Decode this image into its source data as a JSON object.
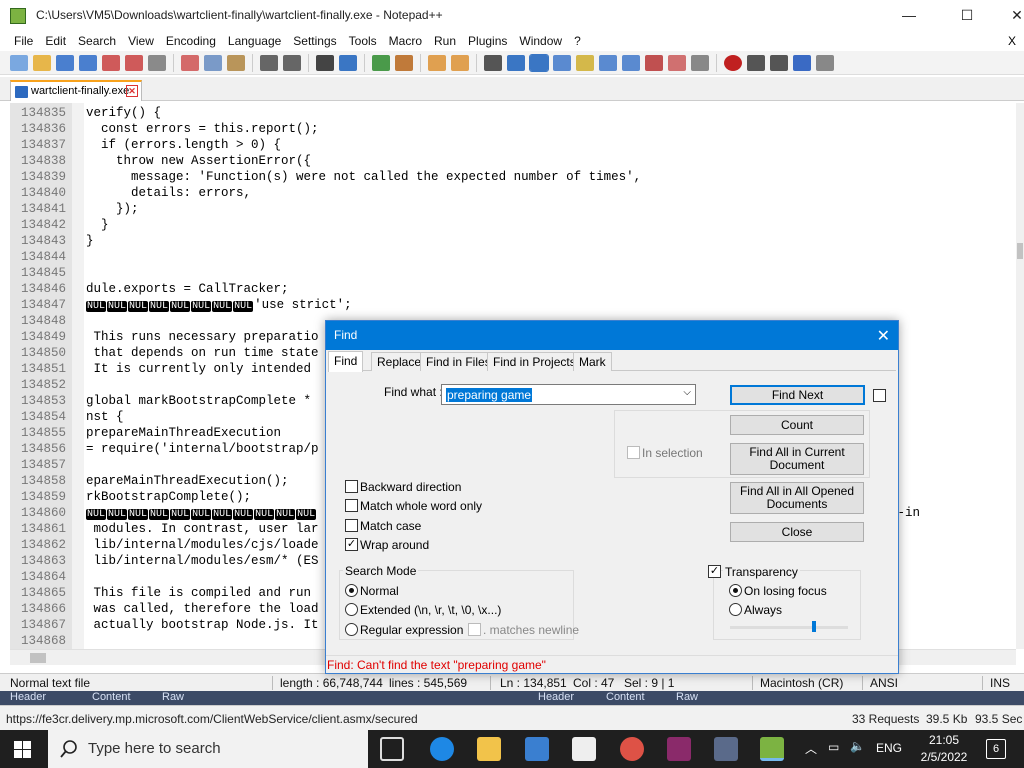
{
  "window": {
    "title": "C:\\Users\\VM5\\Downloads\\wartclient-finally\\wartclient-finally.exe - Notepad++",
    "minimize": "—",
    "maximize": "☐",
    "close": "✕"
  },
  "menu": {
    "items": [
      "File",
      "Edit",
      "Search",
      "View",
      "Encoding",
      "Language",
      "Settings",
      "Tools",
      "Macro",
      "Run",
      "Plugins",
      "Window",
      "?"
    ],
    "close_x": "X"
  },
  "tab": {
    "label": "wartclient-finally.exe",
    "close": "✕"
  },
  "editor": {
    "lines": [
      {
        "n": "134835",
        "code": "verify() {"
      },
      {
        "n": "134836",
        "code": "  const errors = this.report();"
      },
      {
        "n": "134837",
        "code": "  if (errors.length > 0) {"
      },
      {
        "n": "134838",
        "code": "    throw new AssertionError({"
      },
      {
        "n": "134839",
        "code": "      message: 'Function(s) were not called the expected number of times',"
      },
      {
        "n": "134840",
        "code": "      details: errors,"
      },
      {
        "n": "134841",
        "code": "    });"
      },
      {
        "n": "134842",
        "code": "  }"
      },
      {
        "n": "134843",
        "code": "}"
      },
      {
        "n": "134844",
        "code": ""
      },
      {
        "n": "134845",
        "code": ""
      },
      {
        "n": "134846",
        "code": "dule.exports = CallTracker;"
      },
      {
        "n": "134847",
        "code": "'use strict';",
        "nul": 8
      },
      {
        "n": "134848",
        "code": ""
      },
      {
        "n": "134849",
        "code": " This runs necessary preparatio"
      },
      {
        "n": "134850",
        "code": " that depends on run time state"
      },
      {
        "n": "134851",
        "code": " It is currently only intended"
      },
      {
        "n": "134852",
        "code": ""
      },
      {
        "n": "134853",
        "code": "global markBootstrapComplete *"
      },
      {
        "n": "134854",
        "code": "nst {"
      },
      {
        "n": "134855",
        "code": "prepareMainThreadExecution"
      },
      {
        "n": "134856",
        "code": "= require('internal/bootstrap/p"
      },
      {
        "n": "134857",
        "code": ""
      },
      {
        "n": "134858",
        "code": "epareMainThreadExecution();"
      },
      {
        "n": "134859",
        "code": "rkBootstrapComplete();"
      },
      {
        "n": "134860",
        "code": "",
        "nul": 11,
        "tail": "t-in"
      },
      {
        "n": "134861",
        "code": " modules. In contrast, user lar"
      },
      {
        "n": "134862",
        "code": " lib/internal/modules/cjs/loade"
      },
      {
        "n": "134863",
        "code": " lib/internal/modules/esm/* (ES"
      },
      {
        "n": "134864",
        "code": ""
      },
      {
        "n": "134865",
        "code": " This file is compiled and run"
      },
      {
        "n": "134866",
        "code": " was called, therefore the load"
      },
      {
        "n": "134867",
        "code": " actually bootstrap Node.js. It"
      },
      {
        "n": "134868",
        "code": ""
      }
    ],
    "nul_token": "NUL"
  },
  "find_dialog": {
    "title": "Find",
    "close": "✕",
    "tabs": [
      "Find",
      "Replace",
      "Find in Files",
      "Find in Projects",
      "Mark"
    ],
    "find_what_label": "Find what :",
    "find_what_value": "preparing game",
    "in_selection": "In selection",
    "backward": "Backward direction",
    "match_whole_word": "Match whole word only",
    "match_case": "Match case",
    "wrap_around": "Wrap around",
    "search_mode_title": "Search Mode",
    "mode_normal": "Normal",
    "mode_extended": "Extended (\\n, \\r, \\t, \\0, \\x...)",
    "mode_regex": "Regular expression",
    "matches_newline": ". matches newline",
    "transparency": "Transparency",
    "on_losing_focus": "On losing focus",
    "always": "Always",
    "btn_find_next": "Find Next",
    "btn_count": "Count",
    "btn_find_all_current": "Find All in Current Document",
    "btn_find_all_opened": "Find All in All Opened Documents",
    "btn_close": "Close",
    "status": "Find: Can't find the text \"preparing game\"",
    "status_color": "#e00000",
    "wrap_checked": true,
    "transparency_checked": true
  },
  "statusbar": {
    "type": "Normal text file",
    "length": "length : 66,748,744",
    "lines": "lines : 545,569",
    "position": "Ln : 134,851",
    "col": "Col : 47",
    "sel": "Sel : 9 | 1",
    "eol": "Macintosh (CR)",
    "encoding": "ANSI",
    "mode": "INS"
  },
  "background_browser": {
    "tabs_left": [
      "Header",
      "Content",
      "Raw"
    ],
    "tabs_right": [
      "Header",
      "Content",
      "Raw"
    ],
    "url": "https://fe3cr.delivery.mp.microsoft.com/ClientWebService/client.asmx/secured",
    "requests": "33 Requests",
    "size": "39.5 Kb",
    "time": "93.5 Sec"
  },
  "taskbar": {
    "search_placeholder": "Type here to search",
    "lang": "ENG",
    "time": "21:05",
    "date": "2/5/2022",
    "notifications": "6"
  },
  "colors": {
    "dialog_title": "#0078d7",
    "tab_accent": "#f8a21c",
    "taskbar": "#1f1f1f"
  }
}
